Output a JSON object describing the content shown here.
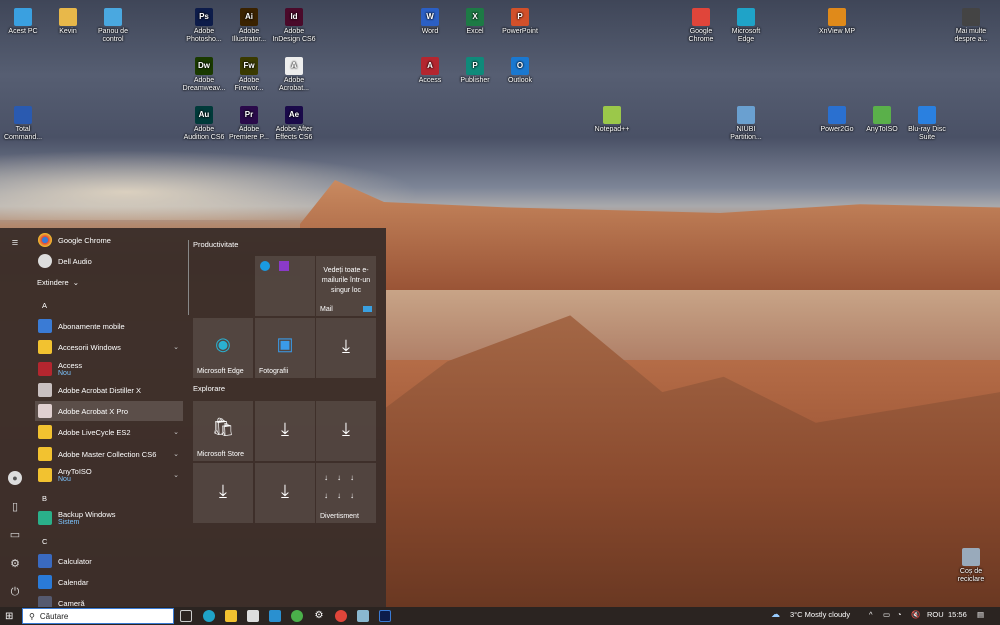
{
  "desktop_icons": [
    {
      "label": "Acest PC",
      "color": "#3aa0e0"
    },
    {
      "label": "Kevin",
      "color": "#e8b84a"
    },
    {
      "label": "Panou de control",
      "color": "#4aa8e0"
    },
    {
      "label": "Adobe Photosho...",
      "color": "#0d1c4a",
      "glyph": "Ps"
    },
    {
      "label": "Adobe Illustrator...",
      "color": "#3a2200",
      "glyph": "Ai"
    },
    {
      "label": "Adobe InDesign CS6",
      "color": "#4a0a2a",
      "glyph": "Id"
    },
    {
      "label": "Adobe Dreamweav...",
      "color": "#1a3a00",
      "glyph": "Dw"
    },
    {
      "label": "Adobe Firewor...",
      "color": "#3a3a00",
      "glyph": "Fw"
    },
    {
      "label": "Adobe Acrobat...",
      "color": "#eee",
      "glyph": "A"
    },
    {
      "label": "Adobe Audition CS6",
      "color": "#003a3a",
      "glyph": "Au"
    },
    {
      "label": "Adobe Premiere P...",
      "color": "#2a0a4a",
      "glyph": "Pr"
    },
    {
      "label": "Adobe After Effects CS6",
      "color": "#1a0a4a",
      "glyph": "Ae"
    },
    {
      "label": "Total Command...",
      "color": "#2a5ab0"
    },
    {
      "label": "Word",
      "color": "#2b5fc4",
      "glyph": "W"
    },
    {
      "label": "Excel",
      "color": "#1d7a45",
      "glyph": "X"
    },
    {
      "label": "PowerPoint",
      "color": "#d2502a",
      "glyph": "P"
    },
    {
      "label": "Access",
      "color": "#b4262f",
      "glyph": "A"
    },
    {
      "label": "Publisher",
      "color": "#0f8a7a",
      "glyph": "P"
    },
    {
      "label": "Outlook",
      "color": "#1a78d0",
      "glyph": "O"
    },
    {
      "label": "Notepad++",
      "color": "#9bc84a"
    },
    {
      "label": "Google Chrome",
      "color": "#e0453a"
    },
    {
      "label": "Microsoft Edge",
      "color": "#1fa3c8"
    },
    {
      "label": "NIUBI Partition...",
      "color": "#6aa0d0"
    },
    {
      "label": "XnView MP",
      "color": "#e08a1a"
    },
    {
      "label": "Power2Go",
      "color": "#2a70d0"
    },
    {
      "label": "AnyToISO",
      "color": "#5ab04a"
    },
    {
      "label": "Blu-ray Disc Suite",
      "color": "#2a80e0"
    },
    {
      "label": "Mai multe despre a...",
      "color": "#444"
    },
    {
      "label": "Coș de reciclare",
      "color": "#9ab"
    }
  ],
  "start_menu": {
    "top_apps": [
      "Google Chrome",
      "Dell Audio"
    ],
    "expand_label": "Extindere",
    "letters": [
      "A",
      "B",
      "C"
    ],
    "apps": [
      {
        "label": "Abonamente mobile",
        "color": "#3a7bd5"
      },
      {
        "label": "Accesorii Windows",
        "color": "#f2c230",
        "chevron": "⌄"
      },
      {
        "label": "Access",
        "sub": "Nou",
        "color": "#b4262f"
      },
      {
        "label": "Adobe Acrobat Distiller X",
        "color": "#c9c0c0"
      },
      {
        "label": "Adobe Acrobat X Pro",
        "color": "#e0d0d0"
      },
      {
        "label": "Adobe LiveCycle ES2",
        "color": "#f2c230",
        "chevron": "⌄"
      },
      {
        "label": "Adobe Master Collection CS6",
        "color": "#f2c230",
        "chevron": "⌄"
      },
      {
        "label": "AnyToISO",
        "sub": "Nou",
        "color": "#f2c230",
        "chevron": "⌄"
      },
      {
        "label": "Backup Windows",
        "sub": "Sistem",
        "color": "#2ab08a"
      },
      {
        "label": "Calculator",
        "color": "#3a6ac0"
      },
      {
        "label": "Calendar",
        "color": "#2a7ad8"
      },
      {
        "label": "Cameră",
        "color": "#555a70"
      }
    ],
    "groups": [
      "Productivitate",
      "Explorare"
    ],
    "tiles": {
      "mail_text": "Vedeți toate e-mailurile într-un singur loc",
      "mail": "Mail",
      "edge": "Microsoft Edge",
      "photos": "Fotografii",
      "store": "Microsoft Store",
      "games": "Divertisment"
    }
  },
  "taskbar": {
    "search_placeholder": "Căutare",
    "weather": "3°C  Mostly cloudy",
    "lang": "ROU",
    "time": "15:56"
  }
}
